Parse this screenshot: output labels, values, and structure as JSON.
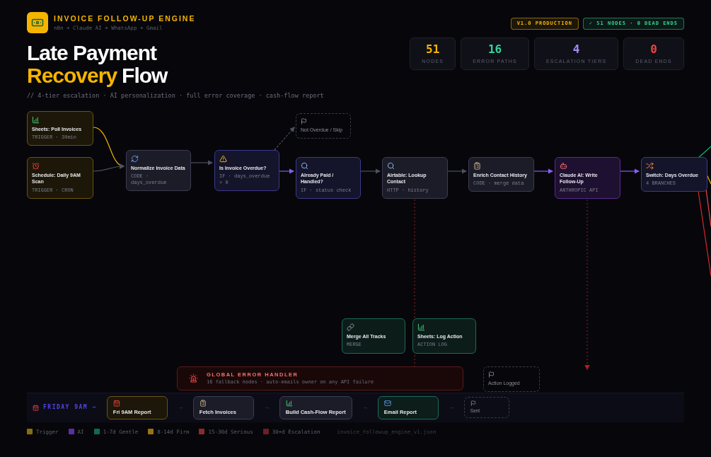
{
  "header": {
    "title": "INVOICE FOLLOW-UP ENGINE",
    "subtitle": "n8n + Claude AI + WhatsApp + Gmail",
    "badges": [
      {
        "label": "V1.0 PRODUCTION",
        "color": "#f5b400"
      },
      {
        "label": "✓ 51 NODES · 0 DEAD ENDS",
        "color": "#34d399"
      }
    ]
  },
  "headline": {
    "line1": "Late Payment",
    "highlight": "Recovery",
    "rest": "Flow"
  },
  "tagline": "// 4-tier escalation · AI personalization · full error coverage · cash-flow report",
  "stats": [
    {
      "value": "51",
      "label": "NODES",
      "color": "#f5b400"
    },
    {
      "value": "16",
      "label": "ERROR PATHS",
      "color": "#34d399"
    },
    {
      "value": "4",
      "label": "ESCALATION TIERS",
      "color": "#a78bfa"
    },
    {
      "value": "0",
      "label": "DEAD ENDS",
      "color": "#ef4444"
    }
  ],
  "nodes": [
    {
      "kind": "trigger",
      "title": "Sheets: Poll Invoices",
      "detail": "TRIGGER · 30min"
    },
    {
      "kind": "trigger",
      "title": "Schedule: Daily 9AM Scan",
      "detail": "TRIGGER · CRON"
    },
    {
      "kind": "code",
      "title": "Normalize Invoice Data",
      "detail": "CODE · days_overdue"
    },
    {
      "kind": "condition",
      "title": "Is Invoice Overdue?",
      "detail": "IF · days_overdue > 0"
    },
    {
      "kind": "terminal",
      "title": "Not Overdue / Skip"
    },
    {
      "kind": "condition",
      "title": "Already Paid / Handled?",
      "detail": "IF · status check"
    },
    {
      "kind": "code",
      "title": "Airtable: Lookup Contact",
      "detail": "HTTP · history"
    },
    {
      "kind": "code",
      "title": "Enrich Contact History",
      "detail": "CODE · merge data"
    },
    {
      "kind": "ai",
      "title": "Claude AI: Write Follow-Up",
      "detail": "ANTHROPIC API"
    },
    {
      "kind": "condition",
      "title": "Switch: Days Overdue",
      "detail": "4 BRANCHES"
    },
    {
      "kind": "merge",
      "title": "Merge All Tracks",
      "detail": "MERGE"
    },
    {
      "kind": "merge",
      "title": "Sheets: Log Action",
      "detail": "ACTION LOG"
    },
    {
      "kind": "terminal",
      "title": "Action Logged"
    }
  ],
  "error_handler": {
    "title": "GLOBAL ERROR HANDLER",
    "detail": "16 fallback nodes · auto-emails owner on any API failure"
  },
  "report": {
    "label": "FRIDAY 9AM →",
    "steps": [
      {
        "kind": "trigger",
        "title": "Fri 9AM Report"
      },
      {
        "kind": "arrow",
        "title": "→"
      },
      {
        "kind": "code",
        "title": "Fetch Invoices"
      },
      {
        "kind": "arrow",
        "title": "→"
      },
      {
        "kind": "code",
        "title": "Build Cash-Flow Report"
      },
      {
        "kind": "arrow",
        "title": "→"
      },
      {
        "kind": "merge",
        "title": "Email Report"
      },
      {
        "kind": "arrow",
        "title": "→"
      },
      {
        "kind": "terminal",
        "title": "Sent"
      }
    ]
  },
  "legend": [
    {
      "label": "Trigger",
      "color": "#8a6d0b"
    },
    {
      "label": "AI",
      "color": "#5b2fa8"
    },
    {
      "label": "1-7d Gentle",
      "color": "#0f6b55"
    },
    {
      "label": "8-14d Firm",
      "color": "#9a7210"
    },
    {
      "label": "15-30d Serious",
      "color": "#8f2a2a"
    },
    {
      "label": "30+d Escalation",
      "color": "#6b1f25"
    }
  ],
  "file_name": "invoice_followup_engine_v1.json"
}
